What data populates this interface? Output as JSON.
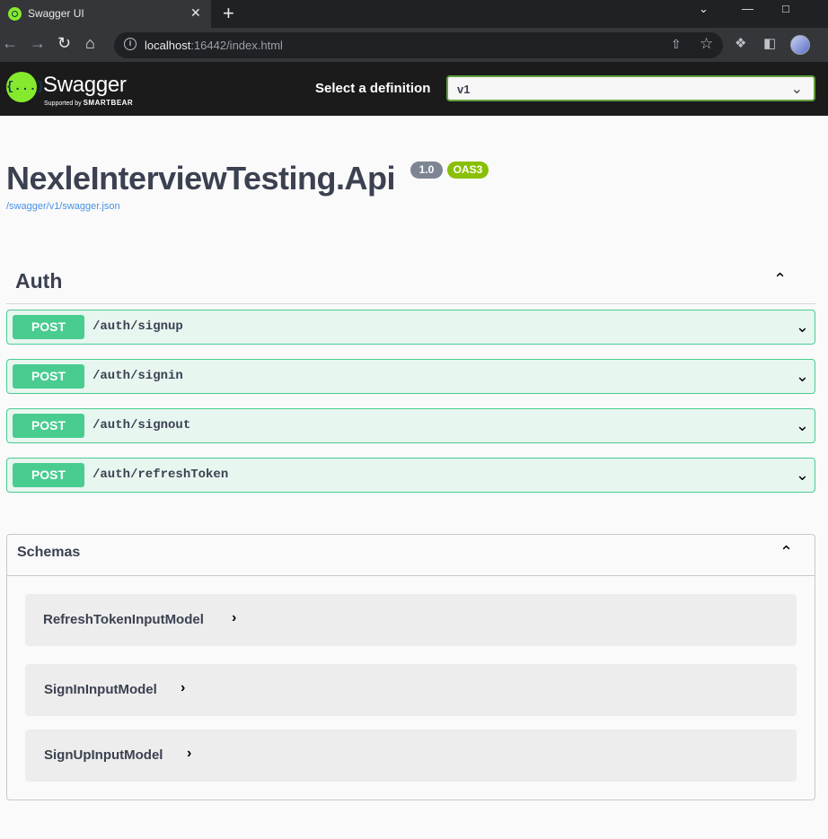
{
  "browser": {
    "tab_title": "Swagger UI",
    "tab_close": "✕",
    "new_tab": "+",
    "url_host": "localhost",
    "url_rest": ":16442/index.html",
    "icons": [
      "back-icon",
      "forward-icon",
      "reload-icon",
      "home-icon",
      "info-icon",
      "share-icon",
      "star-icon",
      "extensions-icon",
      "sidepanel-icon",
      "profile-avatar"
    ]
  },
  "topbar": {
    "logo_mark": "{...}",
    "logo_text": "Swagger",
    "logo_sub_prefix": "Supported by ",
    "logo_sub_brand": "SMARTBEAR",
    "definition_label": "Select a definition",
    "definition_value": "v1"
  },
  "info": {
    "title": "NexleInterviewTesting.Api",
    "version": "1.0",
    "oas": "OAS3",
    "spec_url": "/swagger/v1/swagger.json"
  },
  "tag": {
    "name": "Auth",
    "operations": [
      {
        "method": "POST",
        "path": "/auth/signup"
      },
      {
        "method": "POST",
        "path": "/auth/signin"
      },
      {
        "method": "POST",
        "path": "/auth/signout"
      },
      {
        "method": "POST",
        "path": "/auth/refreshToken"
      }
    ]
  },
  "schemas": {
    "title": "Schemas",
    "models": [
      "RefreshTokenInputModel",
      "SignInInputModel",
      "SignUpInputModel"
    ]
  },
  "colors": {
    "post": "#49cc90",
    "post_bg": "#e8f6f0",
    "topbar": "#1b1b1b",
    "swagger_green": "#85ea2d",
    "link": "#4990e2"
  }
}
